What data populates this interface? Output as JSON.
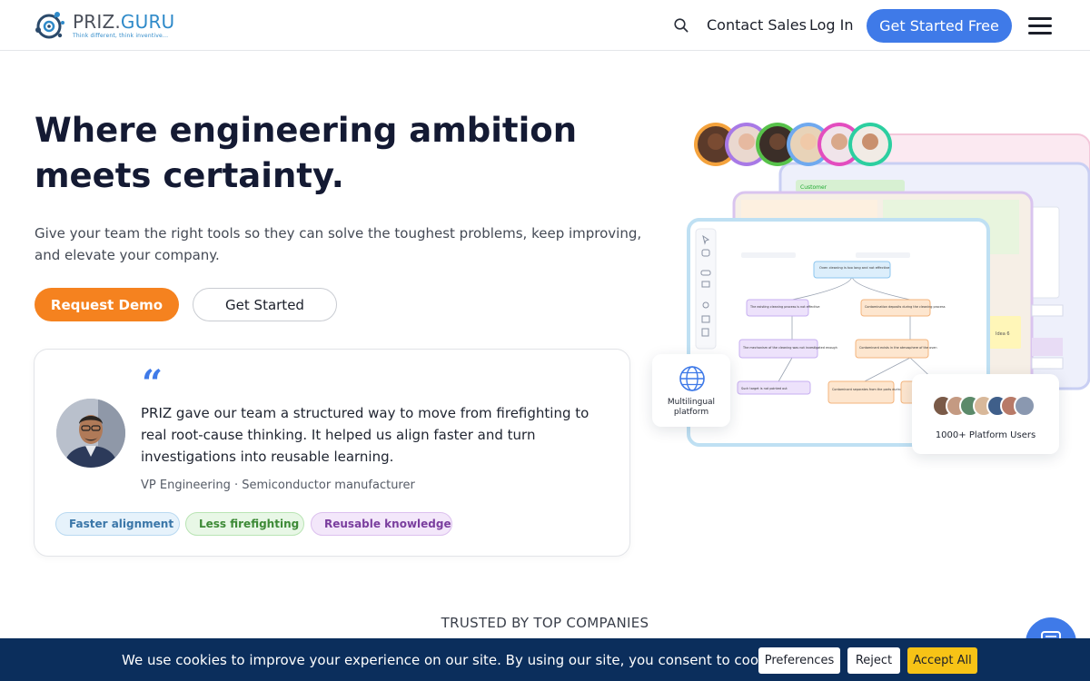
{
  "header": {
    "logo_main": "PRIZ.",
    "logo_accent": "GURU",
    "logo_tagline": "Think different, think inventive...",
    "nav": {
      "contact_sales": "Contact Sales",
      "log_in": "Log In",
      "get_started_free": "Get Started Free"
    },
    "icons": [
      "search-icon",
      "menu-icon"
    ]
  },
  "hero": {
    "title": "Where engineering ambition meets certainty.",
    "subtitle": "Give your team the right tools so they can solve the toughest problems, keep improving, and elevate your company.",
    "primary_button": "Request Demo",
    "secondary_button": "Get Started"
  },
  "testimonial": {
    "quote_glyph": "“",
    "quote": "PRIZ gave our team a structured way to move from firefighting to real root-cause thinking. It helped us align faster and turn investigations into reusable learning.",
    "role": "VP Engineering · Semiconductor manufacturer",
    "chips": [
      {
        "label": "Faster alignment",
        "icon": "cloud-icon"
      },
      {
        "label": "Less firefighting",
        "icon": "refresh-icon"
      },
      {
        "label": "Reusable knowledge",
        "icon": "book-icon"
      }
    ]
  },
  "illustration": {
    "multilingual_label": "Multilingual platform",
    "users_label": "1000+ Platform Users",
    "canvas_nodes": {
      "root": "Oven cleaning is too long and not effective",
      "left_1": "The existing cleaning process is not effective",
      "right_1": "Contamination deposits during the cleaning process",
      "left_2": "The mechanism of the cleaning was not investigated enough",
      "right_2": "Contaminant exists in the atmosphere of the oven",
      "left_3": "Such target is not pointed out",
      "right_3": "Contaminant separates from the parts during the process",
      "sticky": "Idea 6",
      "panel_header": "Customer"
    }
  },
  "trusted": {
    "label": "TRUSTED BY TOP COMPANIES"
  },
  "cookie_bar": {
    "text": "We use cookies to improve your experience on our site. By using our site, you consent to cookies.",
    "preferences": "Preferences",
    "reject": "Reject",
    "accept_all": "Accept All"
  },
  "colors": {
    "primary_blue": "#3f7ae8",
    "orange": "#f5821f",
    "cookie_bg": "#0b2e5c",
    "accept_yellow": "#f7c316",
    "title_navy": "#141a33"
  }
}
